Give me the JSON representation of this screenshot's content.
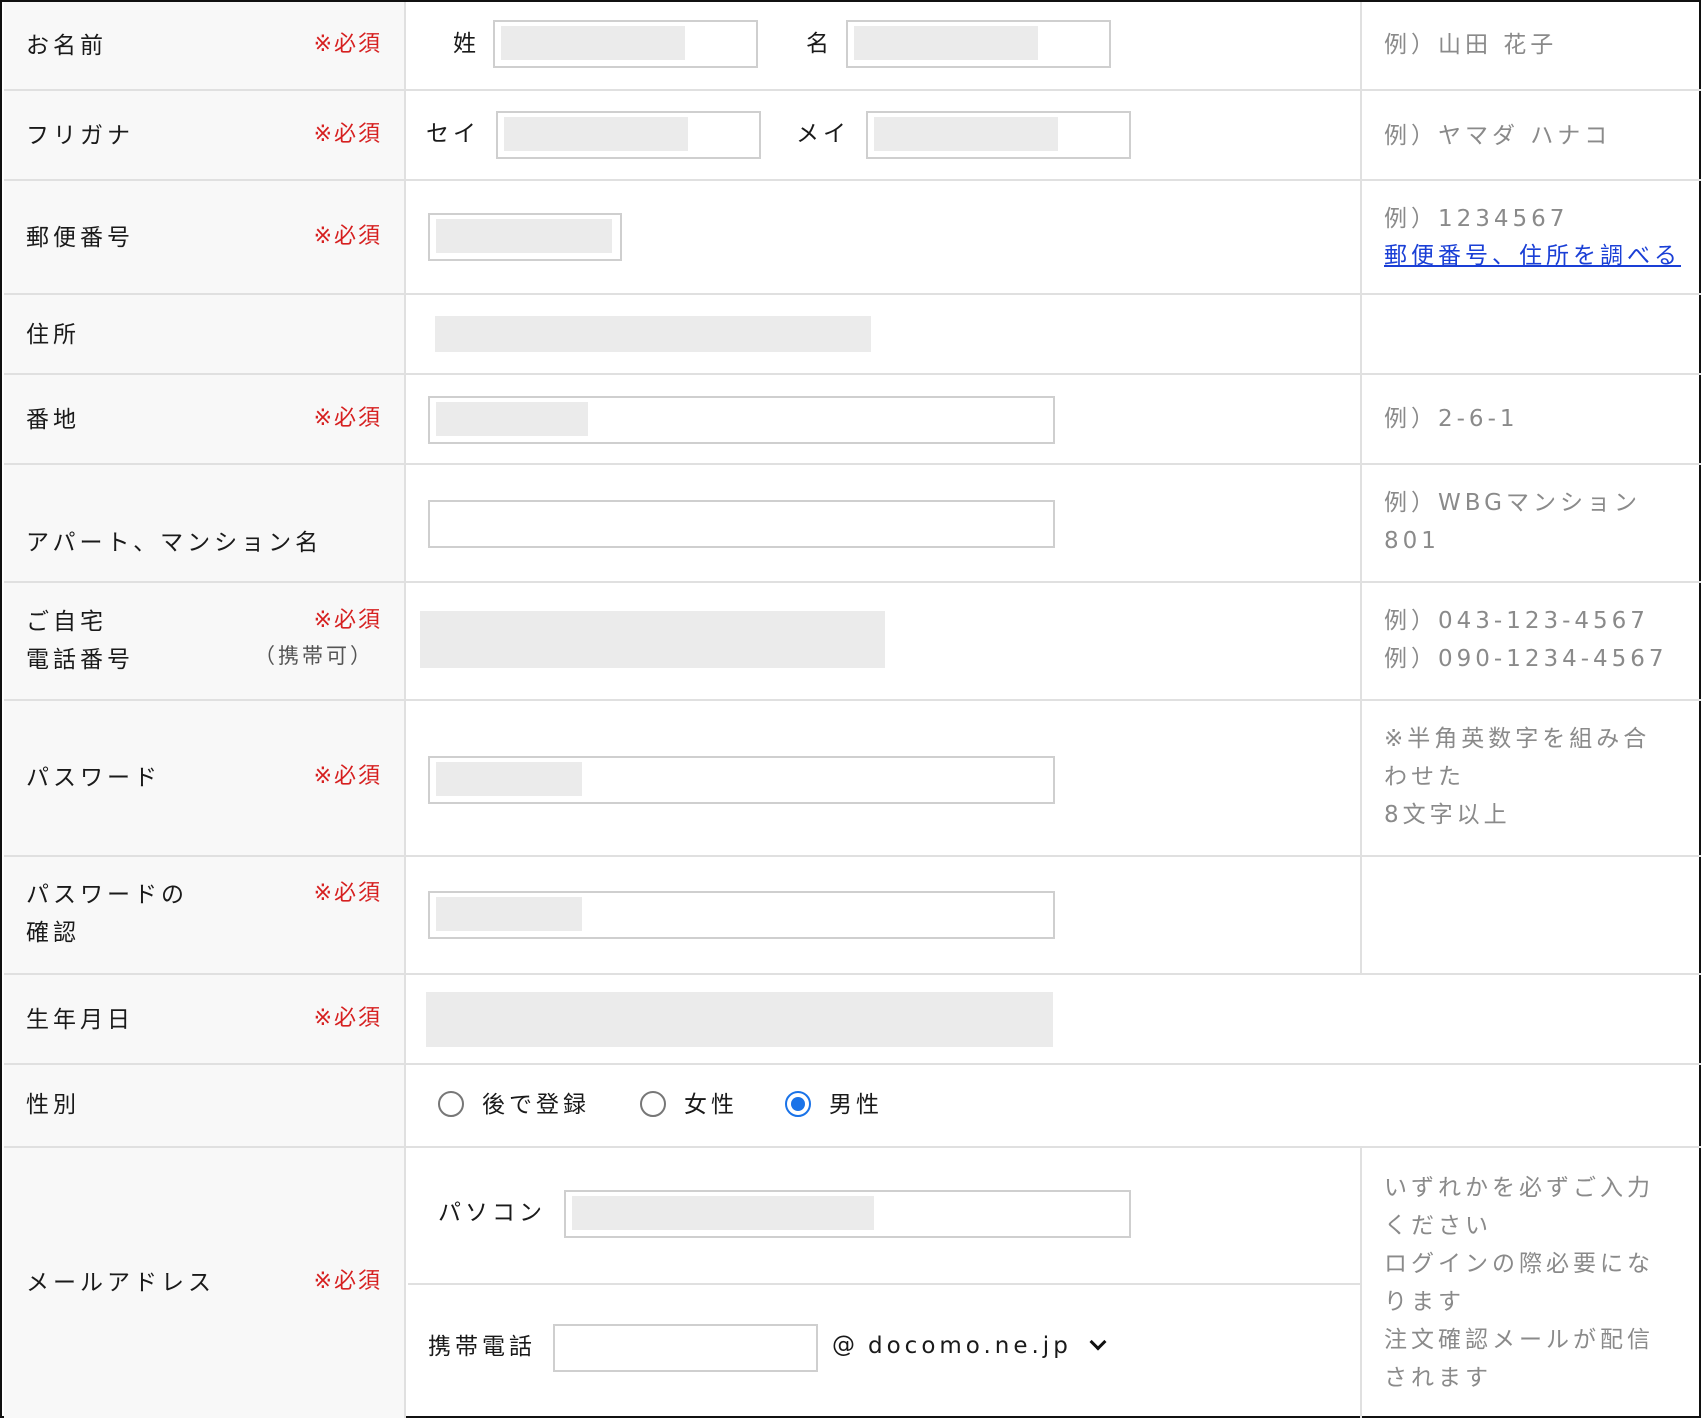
{
  "required_mark": "※必須",
  "colors": {
    "required": "#d62020",
    "example_text": "#8a8a8a",
    "link": "#1a3fd6",
    "radio_selected": "#1a73e8"
  },
  "rows": {
    "name": {
      "label": "お名前",
      "sei_label": "姓",
      "mei_label": "名",
      "example": "例）山田 花子"
    },
    "kana": {
      "label": "フリガナ",
      "sei_label": "セイ",
      "mei_label": "メイ",
      "example": "例）ヤマダ ハナコ"
    },
    "postal": {
      "label": "郵便番号",
      "example": "例）1234567",
      "lookup_link": "郵便番号、住所を調べる"
    },
    "address": {
      "label": "住所"
    },
    "banchi": {
      "label": "番地",
      "example": "例）2-6-1"
    },
    "building": {
      "label": "アパート、マンション名",
      "example_line1": "例）WBGマンション",
      "example_line2": "801"
    },
    "phone": {
      "label_line1": "ご自宅",
      "label_line2": "電話番号",
      "note": "（携帯可）",
      "example_line1": "例）043-123-4567",
      "example_line2": "例）090-1234-4567"
    },
    "password": {
      "label": "パスワード",
      "example_line1": "※半角英数字を組み合",
      "example_line2": "わせた",
      "example_line3": "8文字以上"
    },
    "password_confirm": {
      "label_line1": "パスワードの",
      "label_line2": "確認"
    },
    "birthday": {
      "label": "生年月日"
    },
    "gender": {
      "label": "性別",
      "options": [
        "後で登録",
        "女性",
        "男性"
      ],
      "selected": "男性"
    },
    "email": {
      "label": "メールアドレス",
      "pc_label": "パソコン",
      "mobile_label": "携帯電話",
      "at_sign": "@",
      "domain_selected": "docomo.ne.jp",
      "note_lines": [
        "いずれかを必ずご入力",
        "ください",
        "ログインの際必要にな",
        "ります",
        "注文確認メールが配信",
        "されます"
      ]
    }
  }
}
